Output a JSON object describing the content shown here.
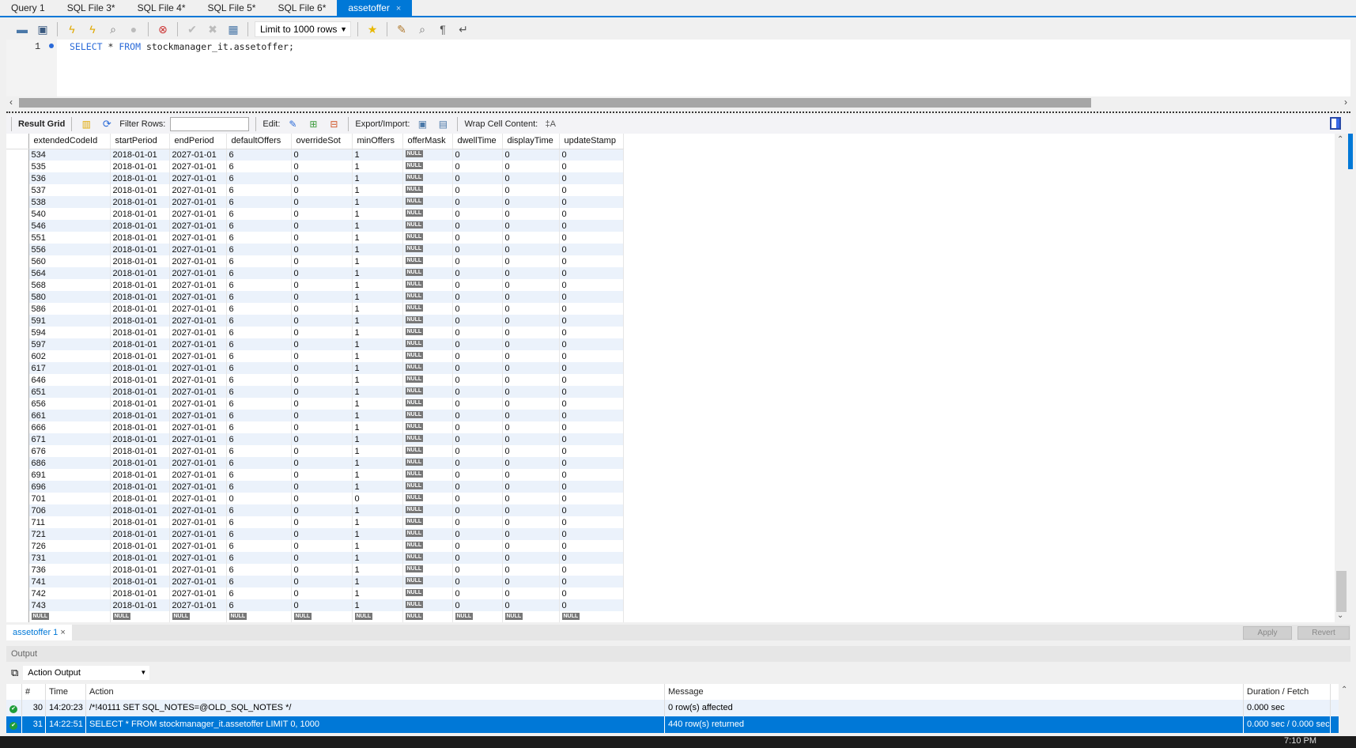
{
  "tabs": [
    {
      "label": "Query 1",
      "active": false
    },
    {
      "label": "SQL File 3*",
      "active": false
    },
    {
      "label": "SQL File 4*",
      "active": false
    },
    {
      "label": "SQL File 5*",
      "active": false
    },
    {
      "label": "SQL File 6*",
      "active": false
    },
    {
      "label": "assetoffer",
      "active": true,
      "close": "×"
    }
  ],
  "toolbar": {
    "limit_select": "Limit to 1000 rows",
    "icons": [
      "open-folder-icon",
      "save-icon",
      "execute-icon",
      "execute-current-icon",
      "explain-icon",
      "stop-icon",
      "toggle-continue-on-error-icon",
      "commit-icon",
      "rollback-icon",
      "autocommit-icon",
      "add-snippet-icon",
      "beautify-icon",
      "find-icon",
      "invisible-chars-icon",
      "wrap-icon"
    ]
  },
  "editor": {
    "line_number": "1",
    "keyword_select": "SELECT",
    "star": " * ",
    "keyword_from": "FROM",
    "table": " stockmanager_it.assetoffer;"
  },
  "result_toolbar": {
    "result_grid": "Result Grid",
    "filter_rows": "Filter Rows:",
    "filter_value": "",
    "edit": "Edit:",
    "export_import": "Export/Import:",
    "wrap_cell": "Wrap Cell Content:"
  },
  "grid": {
    "columns": [
      "extendedCodeId",
      "startPeriod",
      "endPeriod",
      "defaultOffers",
      "overrideSot",
      "minOffers",
      "offerMask",
      "dwellTime",
      "displayTime",
      "updateStamp"
    ],
    "null_label": "NULL",
    "rows": [
      [
        "534",
        "2018-01-01",
        "2027-01-01",
        "6",
        "0",
        "1",
        null,
        "0",
        "0",
        "0"
      ],
      [
        "535",
        "2018-01-01",
        "2027-01-01",
        "6",
        "0",
        "1",
        null,
        "0",
        "0",
        "0"
      ],
      [
        "536",
        "2018-01-01",
        "2027-01-01",
        "6",
        "0",
        "1",
        null,
        "0",
        "0",
        "0"
      ],
      [
        "537",
        "2018-01-01",
        "2027-01-01",
        "6",
        "0",
        "1",
        null,
        "0",
        "0",
        "0"
      ],
      [
        "538",
        "2018-01-01",
        "2027-01-01",
        "6",
        "0",
        "1",
        null,
        "0",
        "0",
        "0"
      ],
      [
        "540",
        "2018-01-01",
        "2027-01-01",
        "6",
        "0",
        "1",
        null,
        "0",
        "0",
        "0"
      ],
      [
        "546",
        "2018-01-01",
        "2027-01-01",
        "6",
        "0",
        "1",
        null,
        "0",
        "0",
        "0"
      ],
      [
        "551",
        "2018-01-01",
        "2027-01-01",
        "6",
        "0",
        "1",
        null,
        "0",
        "0",
        "0"
      ],
      [
        "556",
        "2018-01-01",
        "2027-01-01",
        "6",
        "0",
        "1",
        null,
        "0",
        "0",
        "0"
      ],
      [
        "560",
        "2018-01-01",
        "2027-01-01",
        "6",
        "0",
        "1",
        null,
        "0",
        "0",
        "0"
      ],
      [
        "564",
        "2018-01-01",
        "2027-01-01",
        "6",
        "0",
        "1",
        null,
        "0",
        "0",
        "0"
      ],
      [
        "568",
        "2018-01-01",
        "2027-01-01",
        "6",
        "0",
        "1",
        null,
        "0",
        "0",
        "0"
      ],
      [
        "580",
        "2018-01-01",
        "2027-01-01",
        "6",
        "0",
        "1",
        null,
        "0",
        "0",
        "0"
      ],
      [
        "586",
        "2018-01-01",
        "2027-01-01",
        "6",
        "0",
        "1",
        null,
        "0",
        "0",
        "0"
      ],
      [
        "591",
        "2018-01-01",
        "2027-01-01",
        "6",
        "0",
        "1",
        null,
        "0",
        "0",
        "0"
      ],
      [
        "594",
        "2018-01-01",
        "2027-01-01",
        "6",
        "0",
        "1",
        null,
        "0",
        "0",
        "0"
      ],
      [
        "597",
        "2018-01-01",
        "2027-01-01",
        "6",
        "0",
        "1",
        null,
        "0",
        "0",
        "0"
      ],
      [
        "602",
        "2018-01-01",
        "2027-01-01",
        "6",
        "0",
        "1",
        null,
        "0",
        "0",
        "0"
      ],
      [
        "617",
        "2018-01-01",
        "2027-01-01",
        "6",
        "0",
        "1",
        null,
        "0",
        "0",
        "0"
      ],
      [
        "646",
        "2018-01-01",
        "2027-01-01",
        "6",
        "0",
        "1",
        null,
        "0",
        "0",
        "0"
      ],
      [
        "651",
        "2018-01-01",
        "2027-01-01",
        "6",
        "0",
        "1",
        null,
        "0",
        "0",
        "0"
      ],
      [
        "656",
        "2018-01-01",
        "2027-01-01",
        "6",
        "0",
        "1",
        null,
        "0",
        "0",
        "0"
      ],
      [
        "661",
        "2018-01-01",
        "2027-01-01",
        "6",
        "0",
        "1",
        null,
        "0",
        "0",
        "0"
      ],
      [
        "666",
        "2018-01-01",
        "2027-01-01",
        "6",
        "0",
        "1",
        null,
        "0",
        "0",
        "0"
      ],
      [
        "671",
        "2018-01-01",
        "2027-01-01",
        "6",
        "0",
        "1",
        null,
        "0",
        "0",
        "0"
      ],
      [
        "676",
        "2018-01-01",
        "2027-01-01",
        "6",
        "0",
        "1",
        null,
        "0",
        "0",
        "0"
      ],
      [
        "686",
        "2018-01-01",
        "2027-01-01",
        "6",
        "0",
        "1",
        null,
        "0",
        "0",
        "0"
      ],
      [
        "691",
        "2018-01-01",
        "2027-01-01",
        "6",
        "0",
        "1",
        null,
        "0",
        "0",
        "0"
      ],
      [
        "696",
        "2018-01-01",
        "2027-01-01",
        "6",
        "0",
        "1",
        null,
        "0",
        "0",
        "0"
      ],
      [
        "701",
        "2018-01-01",
        "2027-01-01",
        "0",
        "0",
        "0",
        null,
        "0",
        "0",
        "0"
      ],
      [
        "706",
        "2018-01-01",
        "2027-01-01",
        "6",
        "0",
        "1",
        null,
        "0",
        "0",
        "0"
      ],
      [
        "711",
        "2018-01-01",
        "2027-01-01",
        "6",
        "0",
        "1",
        null,
        "0",
        "0",
        "0"
      ],
      [
        "721",
        "2018-01-01",
        "2027-01-01",
        "6",
        "0",
        "1",
        null,
        "0",
        "0",
        "0"
      ],
      [
        "726",
        "2018-01-01",
        "2027-01-01",
        "6",
        "0",
        "1",
        null,
        "0",
        "0",
        "0"
      ],
      [
        "731",
        "2018-01-01",
        "2027-01-01",
        "6",
        "0",
        "1",
        null,
        "0",
        "0",
        "0"
      ],
      [
        "736",
        "2018-01-01",
        "2027-01-01",
        "6",
        "0",
        "1",
        null,
        "0",
        "0",
        "0"
      ],
      [
        "741",
        "2018-01-01",
        "2027-01-01",
        "6",
        "0",
        "1",
        null,
        "0",
        "0",
        "0"
      ],
      [
        "742",
        "2018-01-01",
        "2027-01-01",
        "6",
        "0",
        "1",
        null,
        "0",
        "0",
        "0"
      ],
      [
        "743",
        "2018-01-01",
        "2027-01-01",
        "6",
        "0",
        "1",
        null,
        "0",
        "0",
        "0"
      ],
      [
        null,
        null,
        null,
        null,
        null,
        null,
        null,
        null,
        null,
        null
      ]
    ]
  },
  "result_tabs": {
    "label": "assetoffer 1",
    "close": "×",
    "apply": "Apply",
    "revert": "Revert"
  },
  "output": {
    "header": "Output",
    "selector": "Action Output",
    "columns": [
      "#",
      "Time",
      "Action",
      "Message",
      "Duration / Fetch"
    ],
    "rows": [
      {
        "num": "30",
        "time": "14:20:23",
        "action": "/*!40111 SET SQL_NOTES=@OLD_SQL_NOTES */",
        "message": "0 row(s) affected",
        "duration": "0.000 sec",
        "selected": false
      },
      {
        "num": "31",
        "time": "14:22:51",
        "action": "SELECT * FROM stockmanager_it.assetoffer LIMIT 0, 1000",
        "message": "440 row(s) returned",
        "duration": "0.000 sec / 0.000 sec",
        "selected": true
      }
    ]
  },
  "taskbar": {
    "clock": "7:10 PM"
  },
  "colors": {
    "accent": "#0078d7",
    "null_badge": "#777777",
    "alt_row": "#ebf2fb",
    "ok_status": "#1f9e3a"
  }
}
